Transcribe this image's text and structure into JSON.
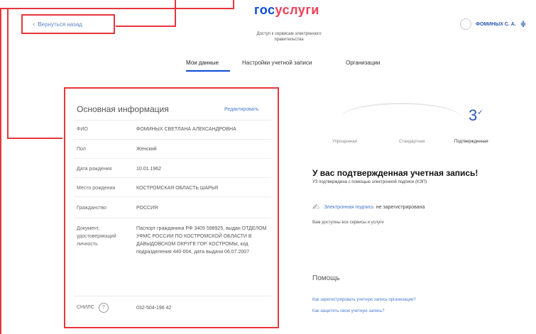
{
  "header": {
    "back_label": "Вернуться назад",
    "logo_gos": "гос",
    "logo_uslugi": "услуги",
    "tagline": "Доступ к сервисам электронного правительства",
    "user_name": "ФОМИНЫХ С. А."
  },
  "tabs": [
    "Мои данные",
    "Настройки учетной записи",
    "Организации"
  ],
  "card": {
    "title": "Основная информация",
    "edit_label": "Редактировать",
    "rows": [
      {
        "label": "ФИО",
        "value": "ФОМИНЫХ СВЕТЛАНА АЛЕКСАНДРОВНА"
      },
      {
        "label": "Пол",
        "value": "Женский"
      },
      {
        "label": "Дата рождения",
        "value": "10.01.1962"
      },
      {
        "label": "Место рождения",
        "value": "КОСТРОМСКАЯ ОБЛАСТЬ ШАРЬЯ"
      },
      {
        "label": "Гражданство",
        "value": "РОССИЯ"
      },
      {
        "label": "Документ, удостоверяющий личность",
        "value": "Паспорт гражданина РФ 3405 598925, выдан ОТДЕЛОМ УФМС РОССИИ ПО КОСТРОМСКОЙ ОБЛАСТИ В ДАВЫДОВСКОМ ОКРУГЕ ГОР. КОСТРОМЫ, код подразделения 440-004, дата выдачи 06.07.2007"
      },
      {
        "label": "СНИЛС",
        "value": "032-504-196 42"
      }
    ]
  },
  "status": {
    "steps": [
      "Упрощенная",
      "Стандартная",
      "Подтвержденная"
    ],
    "level": "3"
  },
  "confirm": {
    "title": "У вас подтвержденная учетная запись!",
    "subtitle": "УЗ подтверждена с помощью электронной подписи (КЭП)",
    "ep_link": "Электронная подпись",
    "ep_rest": "не зарегистрирована",
    "services": "Вам доступны все сервисы и услуги"
  },
  "help": {
    "title": "Помощь",
    "links": [
      "Как зарегистрировать учетную запись организации?",
      "Как защитить свою учетную запись?"
    ]
  },
  "colors": {
    "accent": "#e8353c",
    "brand_blue": "#0d4cd3",
    "brand_red": "#ee3f58"
  }
}
